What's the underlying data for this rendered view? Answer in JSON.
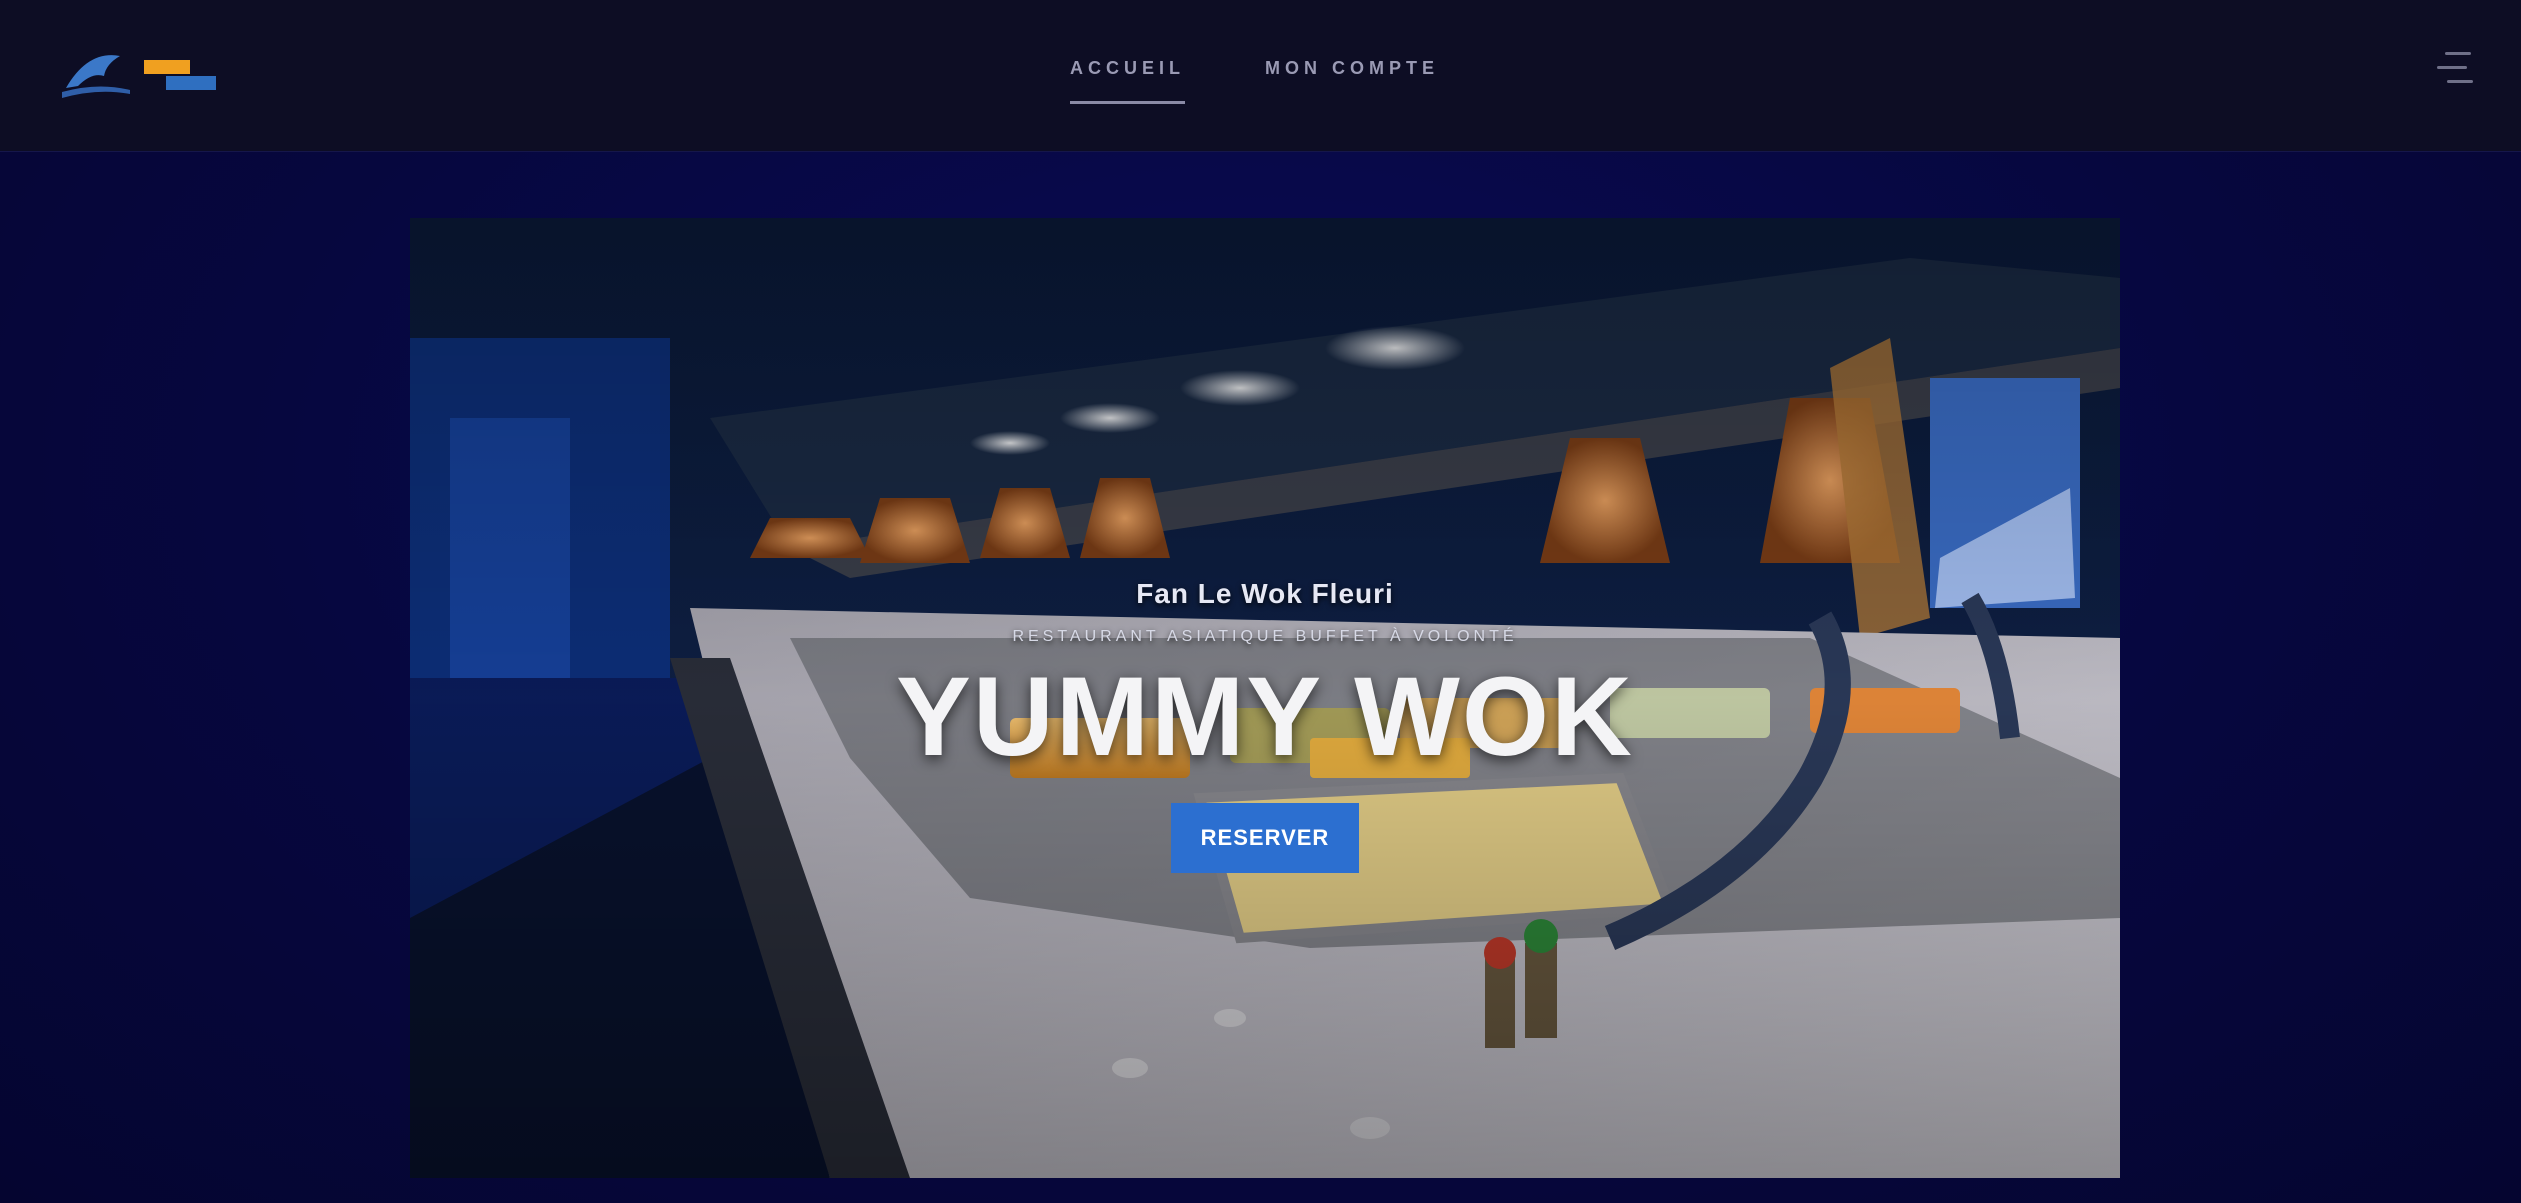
{
  "header": {
    "logo_name": "dolphin-logo",
    "nav": [
      {
        "label": "ACCUEIL",
        "active": true
      },
      {
        "label": "MON COMPTE",
        "active": false
      }
    ],
    "menu_icon": "menu-toggle-icon"
  },
  "hero": {
    "subtitle": "Fan Le Wok Fleuri",
    "tagline": "Restaurant Asiatique Buffet à Volonté",
    "title": "YUMMY WOK",
    "button_label": "RESERVER"
  },
  "colors": {
    "page_background": "#06073a",
    "header_background": "#0d0d24",
    "button": "#2c6fd0",
    "logo_accent": "#f0a020"
  }
}
